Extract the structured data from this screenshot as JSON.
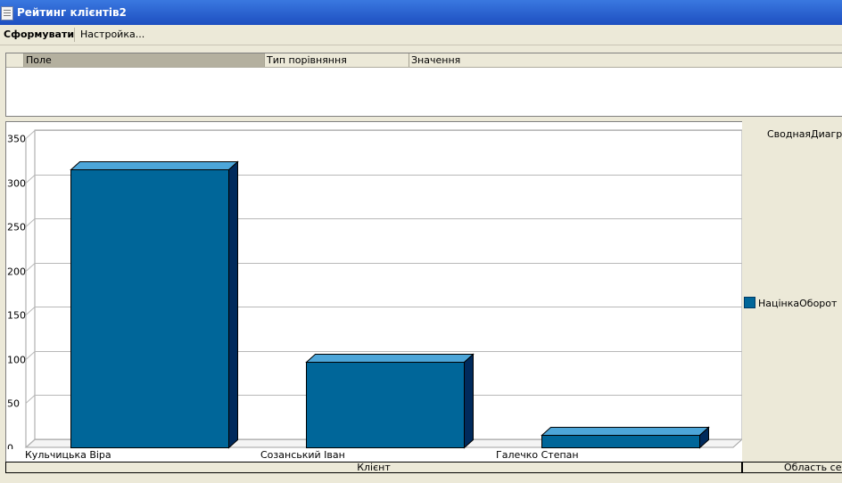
{
  "window": {
    "title": "Рейтинг клієнтів2"
  },
  "toolbar": {
    "generate_label": "Сформувати",
    "settings_label": "Настройка..."
  },
  "filter": {
    "headers": [
      "Поле",
      "Тип порівняння",
      "Значення"
    ]
  },
  "legend": {
    "title": "СводнаяДиаграмма",
    "series_name": "НацінкаОборот"
  },
  "axis_field": "Клієнт",
  "series_area": "Область серий",
  "colors": {
    "bar_front": "#006699",
    "bar_top": "#4da6d9",
    "bar_side": "#002a5c"
  },
  "chart_data": {
    "type": "bar",
    "categories": [
      "Кульчицька Віра",
      "Созанський Іван",
      "Галечко Степан"
    ],
    "series": [
      {
        "name": "НацінкаОборот",
        "values": [
          315,
          97,
          14
        ]
      }
    ],
    "ylim": [
      0,
      350
    ],
    "yticks": [
      "0",
      "50",
      "100",
      "150",
      "200",
      "250",
      "300",
      "350"
    ],
    "grid": true,
    "legend_position": "right"
  }
}
